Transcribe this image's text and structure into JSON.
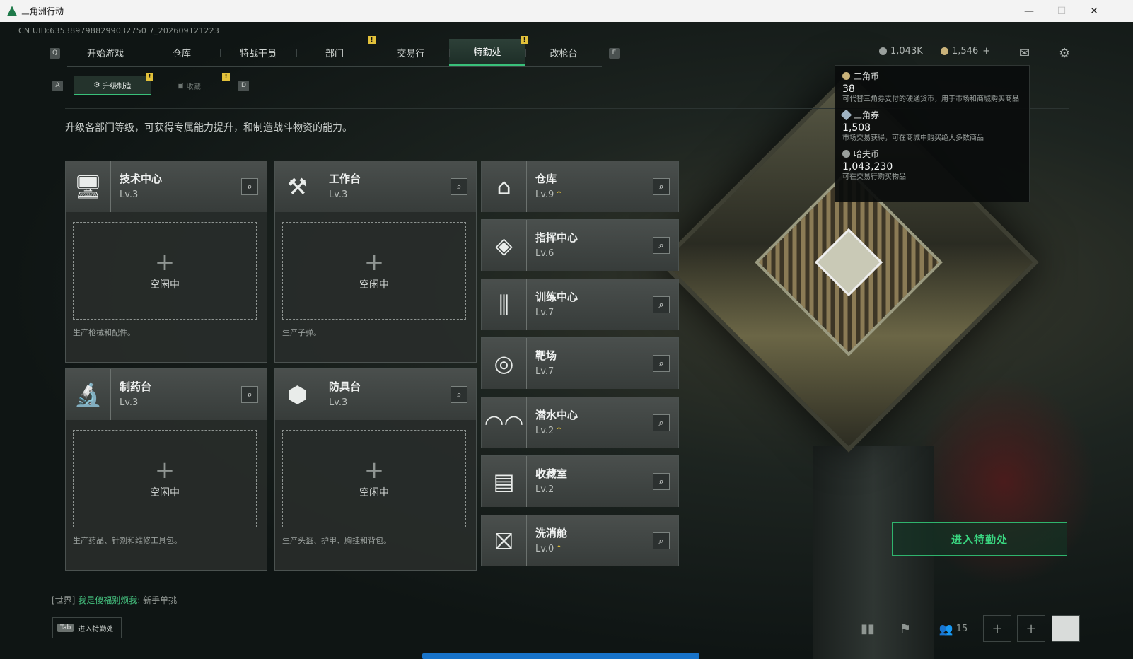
{
  "window": {
    "title": "三角洲行动",
    "minimize": "—",
    "maximize": "☐",
    "close": "✕"
  },
  "uid": "CN UID:6353897988299032750 7_202609121223",
  "nav": {
    "left_key": "Q",
    "right_key": "E",
    "tabs": [
      "开始游戏",
      "仓库",
      "特战干员",
      "部门",
      "交易行",
      "特勤处",
      "改枪台"
    ],
    "active": "特勤处"
  },
  "subnav": {
    "left_key": "A",
    "right_key": "D",
    "items": [
      "升级制造",
      "收藏"
    ],
    "active": "升级制造"
  },
  "currency": {
    "haf": "1,043K",
    "coupon": "1,546",
    "plus": "+"
  },
  "description": "升级各部门等级，可获得专属能力提升，和制造战斗物资的能力。",
  "production": [
    {
      "name": "技术中心",
      "level": "Lv.3",
      "status": "空闲中",
      "footer": "生产枪械和配件。",
      "icon": "monitor-icon"
    },
    {
      "name": "工作台",
      "level": "Lv.3",
      "status": "空闲中",
      "footer": "生产子弹。",
      "icon": "tools-icon"
    },
    {
      "name": "制药台",
      "level": "Lv.3",
      "status": "空闲中",
      "footer": "生产药品、针剂和维修工具包。",
      "icon": "microscope-icon"
    },
    {
      "name": "防具台",
      "level": "Lv.3",
      "status": "空闲中",
      "footer": "生产头盔、护甲、胸挂和背包。",
      "icon": "cubes-icon"
    }
  ],
  "departments": [
    {
      "name": "仓库",
      "level": "Lv.9",
      "upgrade": true
    },
    {
      "name": "指挥中心",
      "level": "Lv.6",
      "upgrade": false
    },
    {
      "name": "训练中心",
      "level": "Lv.7",
      "upgrade": false
    },
    {
      "name": "靶场",
      "level": "Lv.7",
      "upgrade": false
    },
    {
      "name": "潜水中心",
      "level": "Lv.2",
      "upgrade": true
    },
    {
      "name": "收藏室",
      "level": "Lv.2",
      "upgrade": false
    },
    {
      "name": "洗消舱",
      "level": "Lv.0",
      "upgrade": true
    }
  ],
  "tooltip": [
    {
      "name": "三角币",
      "value": "38",
      "desc": "可代替三角券支付的硬通货币，用于市场和商城购买商品"
    },
    {
      "name": "三角券",
      "value": "1,508",
      "desc": "市场交易获得，可在商城中购买绝大多数商品"
    },
    {
      "name": "哈夫币",
      "value": "1,043,230",
      "desc": "可在交易行购买物品"
    }
  ],
  "enter_button": "进入特勤处",
  "chat": {
    "channel": "[世界]",
    "user": "我是傻福别烦我:",
    "message": "新手单挑"
  },
  "tab_hint": {
    "key": "Tab",
    "label": "进入特勤处"
  },
  "friends_count": "15",
  "colors": {
    "accent": "#39c07a",
    "badge": "#e2c13a",
    "panel": "#3a3f3d"
  }
}
